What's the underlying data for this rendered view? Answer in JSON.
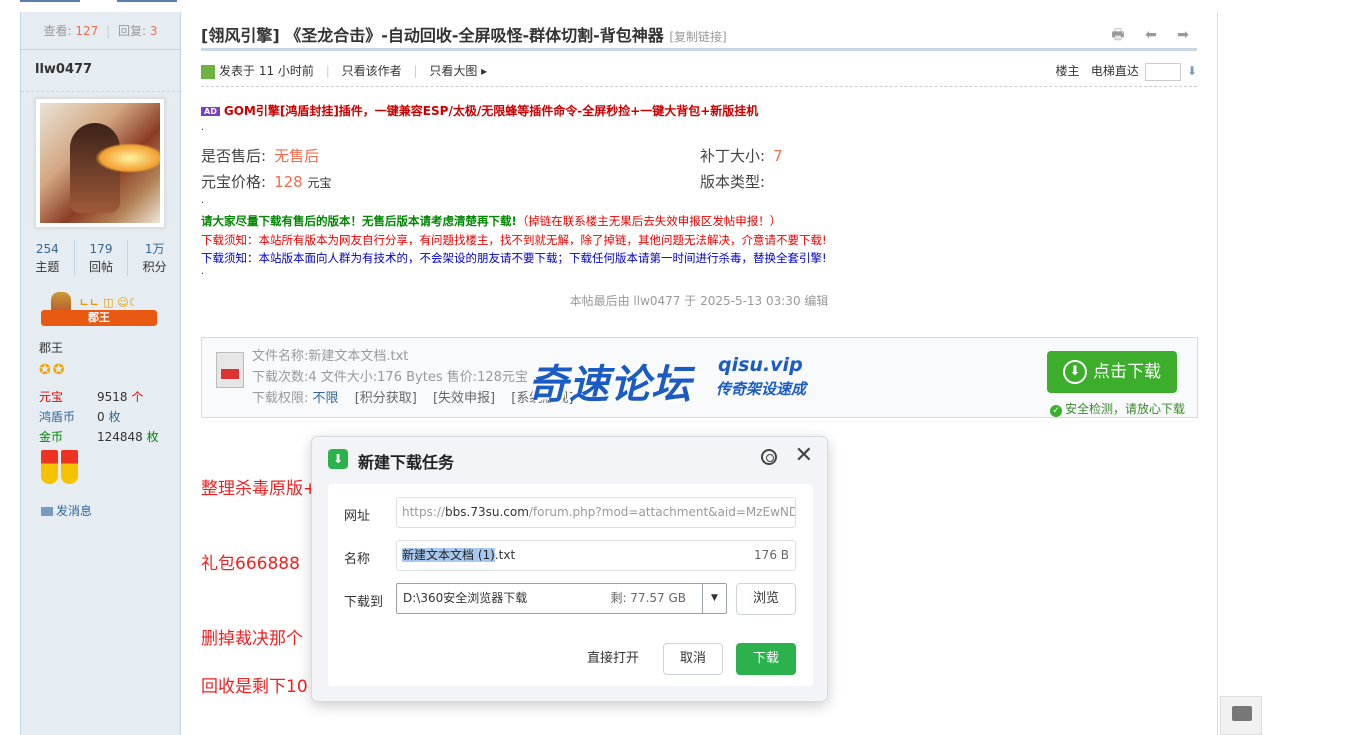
{
  "sidebar": {
    "views_label": "查看:",
    "views": "127",
    "replies_label": "回复:",
    "replies": "3",
    "username": "llw0477",
    "stats": [
      {
        "num": "254",
        "label": "主题"
      },
      {
        "num": "179",
        "label": "回帖"
      },
      {
        "num": "1万",
        "label": "积分"
      }
    ],
    "rank_badge": "郡王",
    "rank_dots": "ㄴㄴ ◫ ☺☾",
    "group": "郡王",
    "stars": "✪✪",
    "attrs": [
      {
        "k": "元宝",
        "v": "9518",
        "u": "个",
        "kcolor": "#e00",
        "ucolor": "#e00"
      },
      {
        "k": "鸿盾币",
        "v": "0",
        "u": "枚",
        "kcolor": "#369",
        "ucolor": "#369"
      },
      {
        "k": "金币",
        "v": "124848",
        "u": "枚",
        "kcolor": "#080",
        "ucolor": "#080"
      }
    ],
    "send_msg": "发消息"
  },
  "post": {
    "title": "[翎风引擎] 《圣龙合击》-自动回收-全屏吸怪-群体切割-背包神器",
    "copy_link": "[复制链接]",
    "icons": "🖶 ⬅ ➡",
    "posted": "发表于 11 小时前",
    "only_author": "只看该作者",
    "big_image": "只看大图 ▸",
    "floor": "楼主",
    "elevator": "电梯直达",
    "elevator_go": "⬇",
    "ad_tag": "AD",
    "ad_text": "GOM引擎[鸿盾封挂]插件，一键兼容ESP/太极/无限蜂等插件命令-全屏秒捡+一键大背包+新版挂机",
    "dot": ".",
    "fields": [
      {
        "k": "是否售后:",
        "v": "无售后",
        "unit": ""
      },
      {
        "k": "补丁大小:",
        "v": "7",
        "unit": ""
      },
      {
        "k": "元宝价格:",
        "v": "128",
        "unit": "元宝"
      },
      {
        "k": "版本类型:",
        "v": "",
        "unit": ""
      }
    ],
    "notice_green": "请大家尽量下载有售后的版本！无售后版本请考虑清楚再下载!",
    "notice_green_tail": "（掉链在联系楼主无果后去失效申报区发帖申报！）",
    "notice_red": "下载须知：本站所有版本为网友自行分享，有问题找楼主，找不到就无解，除了掉链，其他问题无法解决，介意请不要下载!",
    "notice_blue": "下载须知：本站版本面向人群为有技术的，不会架设的朋友请不要下载；下载任何版本请第一时间进行杀毒，替换全套引擎!",
    "edited": "本帖最后由 llw0477 于 2025-5-13 03:30 编辑",
    "attach_name": "文件名称:新建文本文档.txt",
    "attach_info": "下载次数:4  文件大小:176 Bytes  售价:128元宝",
    "attach_perm_label": "下载权限:",
    "attach_perm": "不限",
    "attach_links": [
      "[积分获取]",
      "[失效申报]",
      "[系统版规]"
    ],
    "download_btn": "点击下载",
    "download_arrow": "⬇",
    "safe_text": "安全检测，请放心下载",
    "safe_check": "✓",
    "watermark": {
      "big": "奇速论坛",
      "domain": "qisu.vip",
      "sub": "传奇架设速成"
    },
    "body_lines": [
      "整理杀毒原版+",
      "礼包666888",
      "删掉裁决那个",
      "回收是剩下10"
    ]
  },
  "dialog": {
    "logo": "⬇",
    "title": "新建下载任务",
    "close": "✕",
    "url_label": "网址",
    "url_pre": "https://",
    "url_host": "bbs.73su.com",
    "url_rest": "/forum.php?mod=attachment&aid=MzEwNDY",
    "name_label": "名称",
    "name_sel": "新建文本文档 (1)",
    "name_ext": ".txt",
    "name_size": "176 B",
    "dest_label": "下载到",
    "dest_path": "D:\\360安全浏览器下载",
    "dest_free": "剩: 77.57 GB",
    "dest_arrow": "▼",
    "browse": "浏览",
    "open_direct": "直接打开",
    "cancel": "取消",
    "download": "下载"
  }
}
